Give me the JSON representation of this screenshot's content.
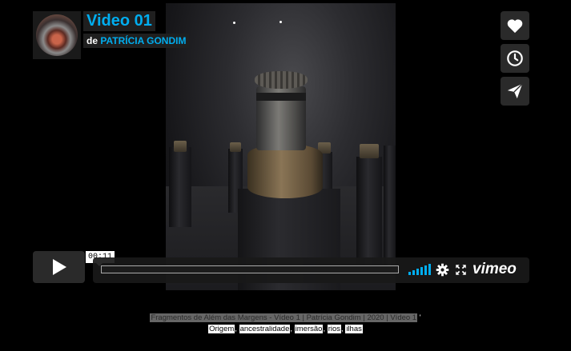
{
  "player": {
    "title": "Video 01",
    "byline_prefix": "de",
    "author": "PATRÍCIA GONDIM",
    "time": "00:11",
    "brand": "vimeo",
    "accent_color": "#00adef"
  },
  "side_buttons": [
    {
      "icon": "heart-icon"
    },
    {
      "icon": "clock-icon"
    },
    {
      "icon": "send-icon"
    }
  ],
  "description": {
    "line1": "Fragmentos de Além das Margens - Vídeo 1 | Patrícia Gondim | 2020 | Vídeo 1",
    "line1_suffix": " '",
    "tags": [
      "Origem",
      "ancestralidade",
      "imersão",
      "rios",
      "ilhas"
    ],
    "separators": [
      ", ",
      ", ",
      ", ",
      ", "
    ]
  }
}
